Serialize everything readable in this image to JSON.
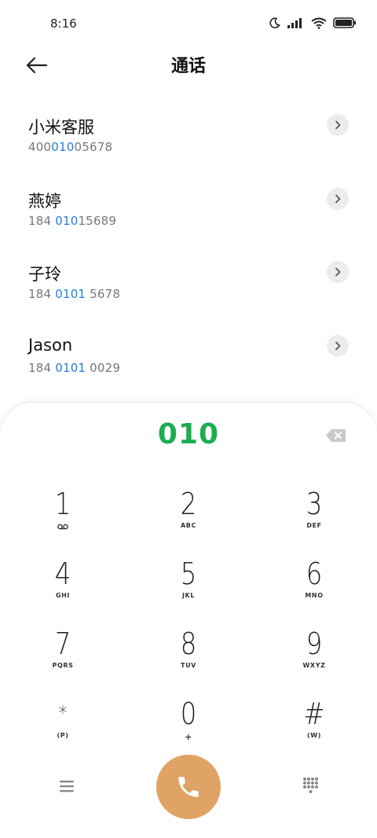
{
  "status_bar": {
    "time": "8:16",
    "icons": [
      "moon-icon",
      "signal-icon",
      "wifi-icon",
      "battery-icon"
    ]
  },
  "header": {
    "title": "通话",
    "back_icon": "back-arrow-icon"
  },
  "contacts": [
    {
      "name": "小米客服",
      "number_pre": "400",
      "number_match": "010",
      "number_post": "05678"
    },
    {
      "name": "燕婷",
      "number_pre": "184 ",
      "number_match": "010",
      "number_post": "15689"
    },
    {
      "name": "子玲",
      "number_pre": "184 ",
      "number_match": "0101",
      "number_post": " 5678"
    },
    {
      "name": "Jason",
      "number_pre": "184 ",
      "number_match": "0101",
      "number_post": " 0029"
    }
  ],
  "dialer": {
    "input_value": "010",
    "keys": [
      {
        "digit": "1",
        "sub": ""
      },
      {
        "digit": "2",
        "sub": "ABC"
      },
      {
        "digit": "3",
        "sub": "DEF"
      },
      {
        "digit": "4",
        "sub": "GHI"
      },
      {
        "digit": "5",
        "sub": "JKL"
      },
      {
        "digit": "6",
        "sub": "MNO"
      },
      {
        "digit": "7",
        "sub": "PQRS"
      },
      {
        "digit": "8",
        "sub": "TUV"
      },
      {
        "digit": "9",
        "sub": "WXYZ"
      },
      {
        "digit": "*",
        "sub": "(P)"
      },
      {
        "digit": "0",
        "sub": "+"
      },
      {
        "digit": "#",
        "sub": "(W)"
      }
    ]
  },
  "colors": {
    "match_highlight": "#1f7fe0",
    "dial_input": "#1dad51",
    "call_button": "#dfa366"
  }
}
